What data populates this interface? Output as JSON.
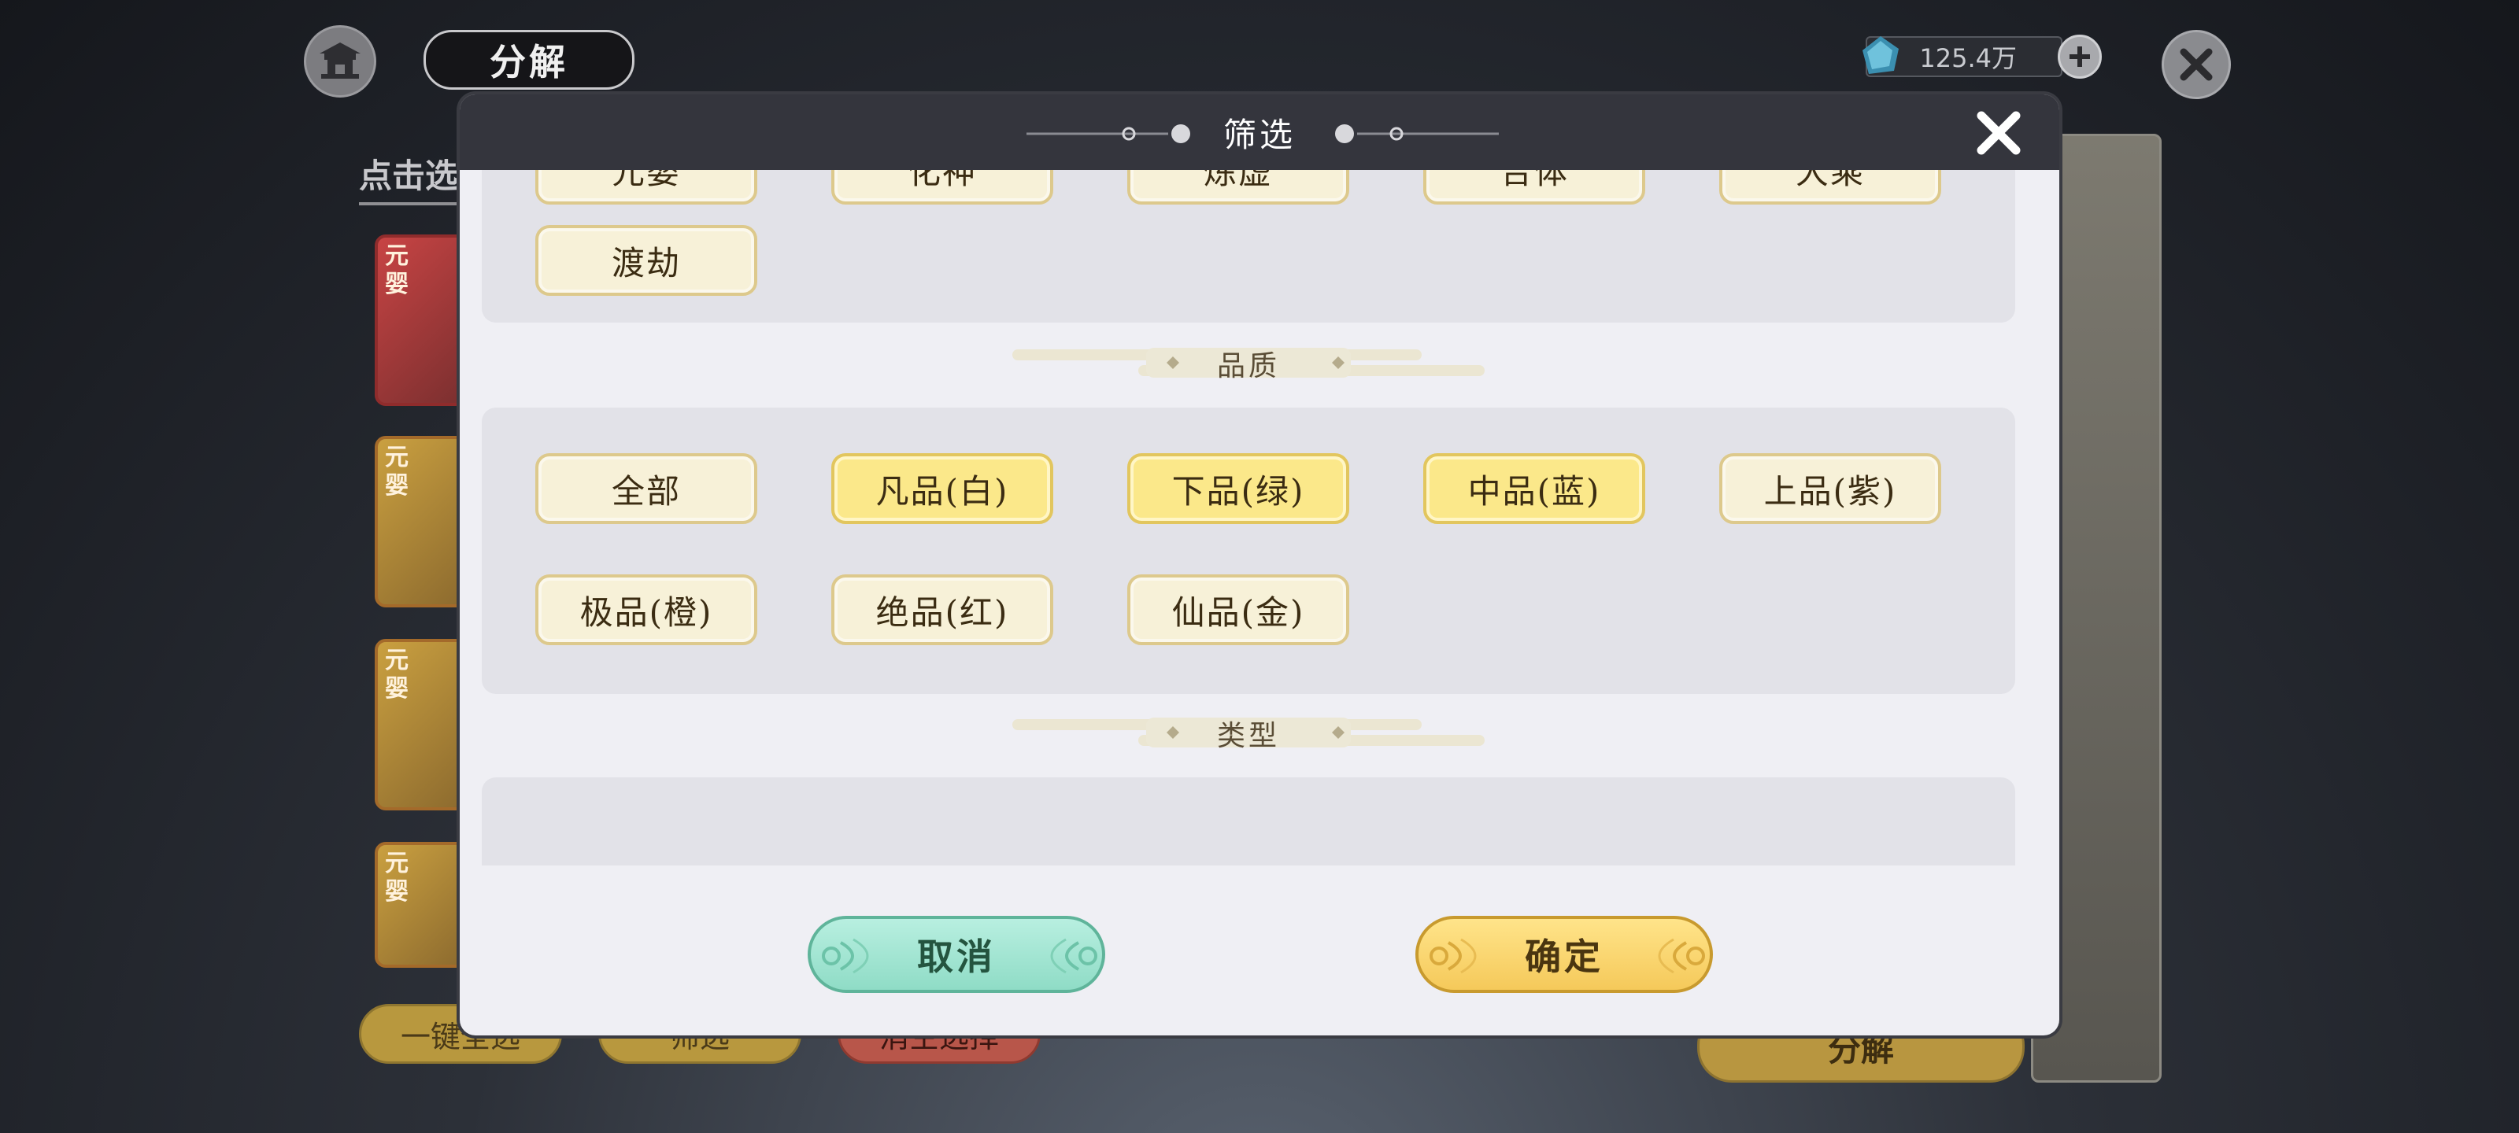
{
  "header": {
    "title": "分解",
    "currency_value": "125.4万"
  },
  "background": {
    "hint_label": "点击选",
    "card_tag": "元婴",
    "buttons": {
      "select_all": "一键全选",
      "filter": "筛选",
      "clear": "消空选择",
      "decompose": "分解"
    }
  },
  "modal": {
    "title": "筛选",
    "realm_options_partial": [
      "元婴",
      "化神",
      "炼虚",
      "合体",
      "大乘"
    ],
    "realm_options": [
      "渡劫"
    ],
    "quality_section_title": "品质",
    "quality_options": [
      {
        "label": "全部",
        "selected": false
      },
      {
        "label": "凡品(白)",
        "selected": true
      },
      {
        "label": "下品(绿)",
        "selected": true
      },
      {
        "label": "中品(蓝)",
        "selected": true
      },
      {
        "label": "上品(紫)",
        "selected": false
      },
      {
        "label": "极品(橙)",
        "selected": false
      },
      {
        "label": "绝品(红)",
        "selected": false
      },
      {
        "label": "仙品(金)",
        "selected": false
      }
    ],
    "type_section_title": "类型",
    "cancel_label": "取消",
    "confirm_label": "确定"
  },
  "colors": {
    "modal_header": "#34353d",
    "option_selected": "#fbe88a",
    "option_unselected": "#f7f1d8",
    "cancel_button": "#9fe3cf",
    "confirm_button": "#f7cf62"
  }
}
